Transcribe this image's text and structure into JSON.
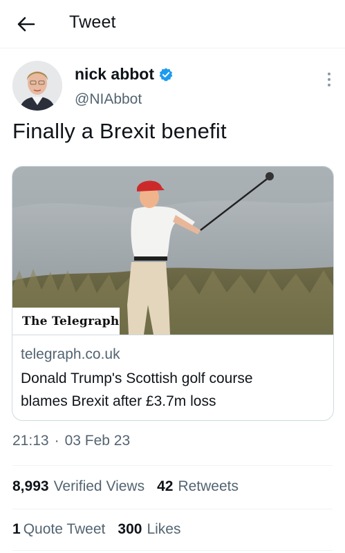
{
  "topbar": {
    "title": "Tweet"
  },
  "author": {
    "name": "nick abbot",
    "handle": "@NIAbbot"
  },
  "tweet": {
    "text": "Finally a Brexit benefit"
  },
  "card": {
    "publisher": "The Telegraph",
    "domain": "telegraph.co.uk",
    "title_line1": "Donald Trump's Scottish golf course",
    "title_line2": "blames Brexit after £3.7m loss"
  },
  "meta": {
    "time": "21:13",
    "separator": "·",
    "date": "03 Feb 23"
  },
  "stats_row1": {
    "views_count": "8,993",
    "views_label": "Verified Views",
    "retweets_count": "42",
    "retweets_label": "Retweets"
  },
  "stats_row2": {
    "quotes_count": "1",
    "quotes_label": "Quote Tweet",
    "likes_count": "300",
    "likes_label": "Likes"
  },
  "colors": {
    "accent": "#1d9bf0",
    "secondary_text": "#536471",
    "primary_text": "#0f1419",
    "border": "#cfd9de"
  },
  "icons": {
    "back": "arrow-left-icon",
    "verified": "verified-badge-icon",
    "more": "more-vertical-icon"
  }
}
